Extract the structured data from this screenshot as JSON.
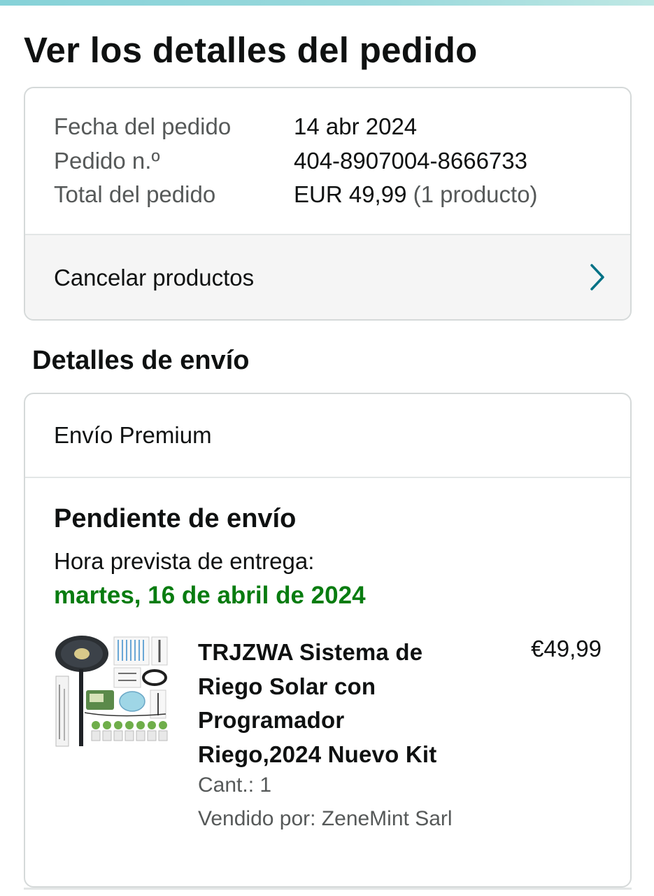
{
  "page": {
    "title": "Ver los detalles del pedido"
  },
  "order": {
    "date_label": "Fecha del pedido",
    "date_value": "14 abr 2024",
    "number_label": "Pedido n.º",
    "number_value": "404-8907004-8666733",
    "total_label": "Total del pedido",
    "total_value": "EUR 49,99",
    "total_count": "(1 producto)",
    "cancel_label": "Cancelar productos"
  },
  "shipping": {
    "section_title": "Detalles de envío",
    "method": "Envío Premium",
    "status": "Pendiente de envío",
    "eta_label": "Hora prevista de entrega:",
    "eta_date": "martes, 16 de abril de 2024"
  },
  "product": {
    "title": "TRJZWA Sistema de Riego Solar con Programador Riego,2024 Nuevo Kit",
    "price": "€49,99",
    "quantity": "Cant.: 1",
    "seller": "Vendido por: ZeneMint Sarl",
    "image_icon": "solar-irrigation-kit-image"
  },
  "colors": {
    "eta_green": "#087c10",
    "chevron_teal": "#007185",
    "border": "#d5d9d9"
  }
}
